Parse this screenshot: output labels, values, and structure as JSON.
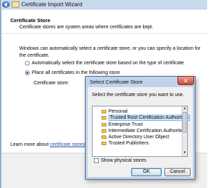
{
  "wizard": {
    "title": "Certificate Import Wizard",
    "heading": "Certificate Store",
    "subheading": "Certificate stores are system areas where certificates are kept.",
    "intro_line1": "Windows can automatically select a certificate store, or you can specify a location for",
    "intro_line2": "the certificate.",
    "options": [
      {
        "label": "Automatically select the certificate store based on the type of certificate",
        "selected": false
      },
      {
        "label": "Place all certificates in the following store",
        "selected": true
      }
    ],
    "store_label": "Certificate store:",
    "learn_more_prefix": "Learn more about ",
    "learn_more_link": "certificate stores"
  },
  "dialog": {
    "title": "Select Certificate Store",
    "close_label": "x",
    "prompt": "Select the certificate store you want to use.",
    "stores": [
      {
        "label": "Personal",
        "selected": false
      },
      {
        "label": "Trusted Root Certification Authorities",
        "selected": true
      },
      {
        "label": "Enterprise Trust",
        "selected": false
      },
      {
        "label": "Intermediate Certification Authorities",
        "selected": false
      },
      {
        "label": "Active Directory User Object",
        "selected": false
      },
      {
        "label": "Trusted Publishers",
        "selected": false
      }
    ],
    "show_physical_label": "Show physical stores",
    "show_physical_checked": false,
    "ok_label": "OK",
    "cancel_label": "Cancel"
  },
  "icons": {
    "back": "back-arrow-icon",
    "wizard": "certificate-icon",
    "folder": "folder-icon",
    "close": "close-icon"
  },
  "colors": {
    "link": "#1a4fa8",
    "selection": "#cde4fb",
    "title_bar": "#c9d9ee"
  }
}
